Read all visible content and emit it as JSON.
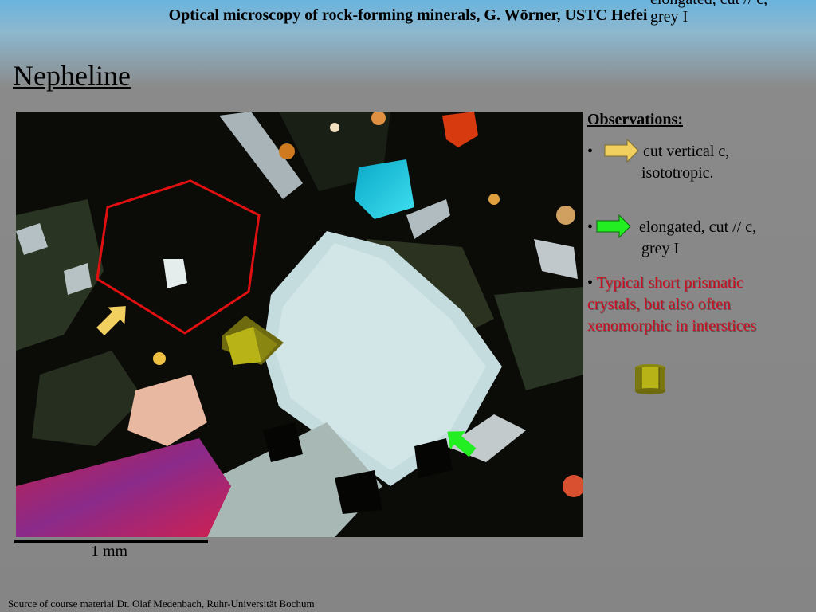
{
  "header": {
    "title": "Optical microscopy of rock-forming minerals, G. Wörner, USTC Hefei",
    "overlap_line1": "elongated, cut // c,",
    "overlap_line2": "grey I"
  },
  "slide": {
    "title": "Nepheline"
  },
  "image": {
    "scale_label": "1 mm"
  },
  "observations": {
    "heading": "Observations:",
    "bullet": "•",
    "item1_line1": "cut vertical c,",
    "item1_line2": "isototropic.",
    "item2_line1": "elongated, cut // c,",
    "item2_line2": "grey I",
    "item3_line1": "Typical short prismatic",
    "item3_line2": "crystals, but also often",
    "item3_line3": "xenomorphic in interstices"
  },
  "colors": {
    "accent_red": "#cc1022",
    "hexagon_outline": "#e01010",
    "arrow_yellow": "#f2d060",
    "arrow_green": "#22ee22",
    "prism_olive": "#b8b418"
  },
  "icons": [
    "yellow-arrow-icon",
    "green-arrow-icon",
    "hexagonal-prism-icon",
    "hexagon-outline"
  ],
  "footer": {
    "source": "Source of course material Dr. Olaf Medenbach, Ruhr-Universität Bochum"
  }
}
